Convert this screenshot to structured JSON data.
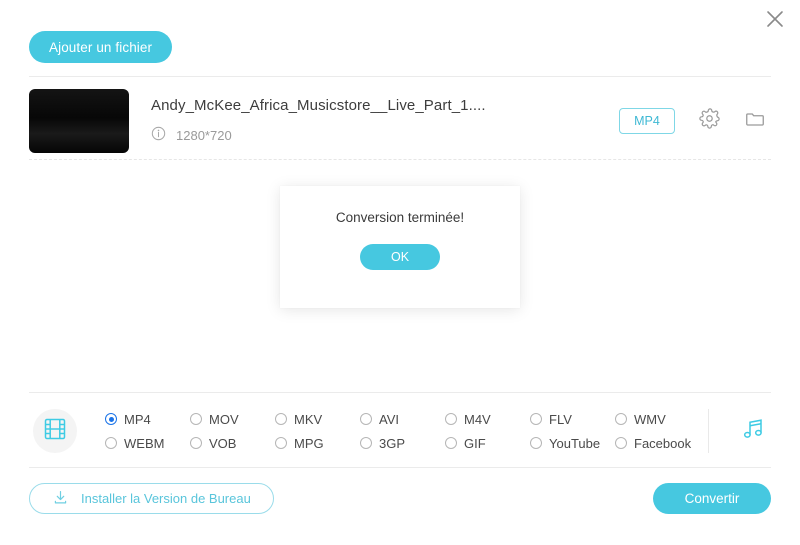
{
  "window": {
    "close_icon": "close-icon"
  },
  "toolbar": {
    "add_file_label": "Ajouter un fichier"
  },
  "file_list": {
    "items": [
      {
        "name": "Andy_McKee_Africa_Musicstore__Live_Part_1....",
        "resolution": "1280*720",
        "info_icon": "info-circle-icon",
        "format_badge": "MP4",
        "settings_icon": "gear-icon",
        "folder_icon": "folder-icon"
      }
    ]
  },
  "modal": {
    "message": "Conversion terminée!",
    "ok_label": "OK"
  },
  "format_panel": {
    "video_icon": "film-strip-icon",
    "audio_icon": "music-note-icon",
    "selected": "MP4",
    "options": [
      "MP4",
      "MOV",
      "MKV",
      "AVI",
      "M4V",
      "FLV",
      "WMV",
      "WEBM",
      "VOB",
      "MPG",
      "3GP",
      "GIF",
      "YouTube",
      "Facebook"
    ]
  },
  "footer": {
    "install_label": "Installer la Version de Bureau",
    "install_icon": "download-icon",
    "convert_label": "Convertir"
  },
  "colors": {
    "accent": "#46c8e0",
    "accent_border": "#7fd7e6",
    "radio_selected": "#1a73e8"
  }
}
